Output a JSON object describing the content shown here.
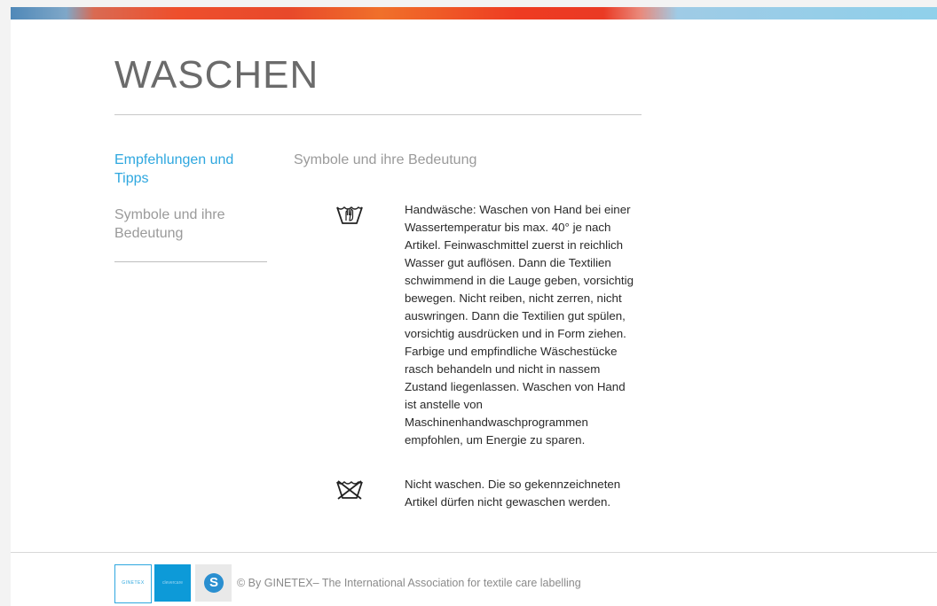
{
  "page": {
    "title": "WASCHEN"
  },
  "sidebar": {
    "items": [
      {
        "label": "Empfehlungen und Tipps",
        "active": true
      },
      {
        "label": "Symbole und ihre Bedeutung",
        "active": false
      }
    ]
  },
  "main": {
    "section_heading": "Symbole und ihre Bedeutung",
    "entries": [
      {
        "icon": "handwash-icon",
        "text": "Handwäsche: Waschen von Hand bei einer Wassertemperatur bis max. 40° je nach Artikel. Feinwaschmittel zuerst in reichlich Wasser gut auflösen. Dann die Textilien schwimmend in die Lauge geben, vorsichtig bewegen. Nicht reiben, nicht zerren, nicht auswringen. Dann die Textilien gut spülen, vorsichtig ausdrücken und in Form ziehen. Farbige und empfindliche Wäschestücke rasch behandeln und nicht in nassem Zustand liegenlassen. Waschen von Hand ist anstelle von Maschinenhandwaschprogrammen empfohlen, um Energie zu sparen."
      },
      {
        "icon": "do-not-wash-icon",
        "text": "Nicht waschen. Die so gekennzeichneten Artikel dürfen nicht gewaschen werden."
      }
    ]
  },
  "footer": {
    "logos": [
      {
        "name": "ginetex-logo",
        "label": "GINETEX"
      },
      {
        "name": "clevercare-logo",
        "label": "clevercare"
      },
      {
        "name": "s-logo",
        "label": "S"
      }
    ],
    "copyright": "© By GINETEX– The International Association for textile care labelling"
  },
  "colors": {
    "accent": "#2ea7df",
    "title": "#6b6b6b",
    "muted": "#9a9a9a",
    "body_text": "#2a2a2a"
  }
}
